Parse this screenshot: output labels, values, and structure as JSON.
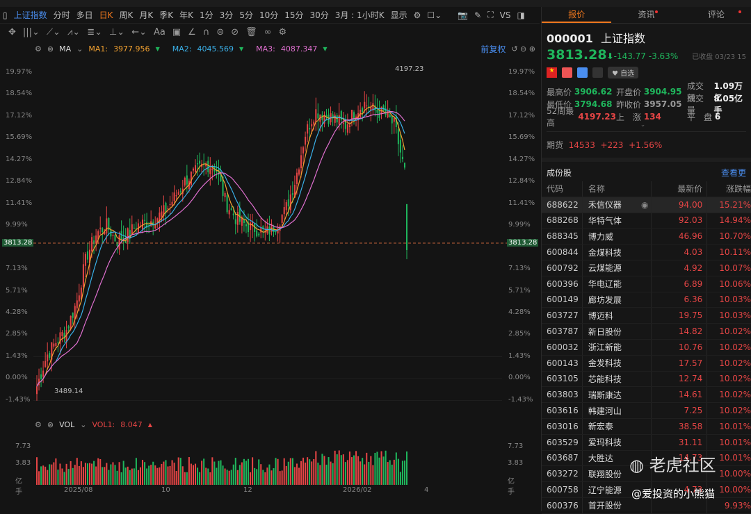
{
  "toolbar": {
    "items": [
      "上证指数",
      "分时",
      "多日",
      "日K",
      "周K",
      "月K",
      "季K",
      "年K",
      "1分",
      "3分",
      "5分",
      "10分",
      "15分",
      "30分",
      "3月 : 1小时K",
      "显示"
    ],
    "selected": "日K",
    "vs": "VS"
  },
  "ma": {
    "label": "MA",
    "ma1": "MA1:",
    "ma1_val": "3977.956",
    "ma2": "MA2:",
    "ma2_val": "4045.569",
    "ma3": "MA3:",
    "ma3_val": "4087.347",
    "adjust": "前复权"
  },
  "axis": {
    "pct": [
      "19.97%",
      "18.54%",
      "17.12%",
      "15.69%",
      "14.27%",
      "12.84%",
      "11.41%",
      "9.99%",
      "8.56%",
      "7.13%",
      "5.71%",
      "4.28%",
      "2.85%",
      "1.43%",
      "0.00%",
      "-1.43%"
    ],
    "current": "3813.28",
    "high_label": "4197.23",
    "low_label": "3489.14"
  },
  "vol": {
    "label": "VOL",
    "vol1": "VOL1:",
    "vol1_val": "8.047",
    "ticks": [
      "7.73",
      "3.83",
      "亿手"
    ],
    "dates": [
      "2025/08",
      "10",
      "12",
      "2026/02",
      "4"
    ]
  },
  "chart_data": {
    "type": "candlestick",
    "ylabel": "%",
    "ylim": [
      -1.9,
      20.5
    ],
    "close_pct_keypoints": [
      -0.5,
      1.5,
      2.5,
      3.2,
      5,
      8,
      9.5,
      10,
      9,
      9.3,
      10,
      10.2,
      10.5,
      11,
      12,
      13,
      13.5,
      14,
      13.8,
      11.5,
      10.5,
      10,
      9.8,
      9.5,
      10,
      11,
      13,
      16,
      17.5,
      17.2,
      17,
      16.5,
      17.5,
      18,
      17.5,
      17.3,
      16.5,
      13.5
    ],
    "last_candle": {
      "open_pct": 11.4,
      "close_pct": 8.4,
      "low_pct": 7.8
    }
  },
  "tabs": [
    {
      "label": "报价"
    },
    {
      "label": "资讯"
    },
    {
      "label": "评论"
    }
  ],
  "quote": {
    "code": "000001",
    "name": "上证指数",
    "price": "3813.28",
    "change": "-143.77",
    "pct": "-3.63%",
    "status": "已收盘 03/23 15",
    "watch": "自选",
    "stats": [
      [
        "最高价",
        "3906.62",
        "g"
      ],
      [
        "开盘价",
        "3904.95",
        "g"
      ],
      [
        "成交额",
        "1.09万亿",
        "w"
      ],
      [
        "最低价",
        "3794.68",
        "g"
      ],
      [
        "昨收价",
        "3957.05",
        "m"
      ],
      [
        "成交量",
        "8.05亿手",
        "w"
      ],
      [
        "52周最高",
        "4197.23",
        "r"
      ],
      [
        "上　涨",
        "134",
        "r"
      ],
      [
        "平　盘",
        "6",
        "w"
      ]
    ],
    "futures": {
      "label": "期货",
      "value": "14533",
      "change": "+223",
      "pct": "+1.56%"
    }
  },
  "constituents": {
    "title": "成份股",
    "more": "查看更",
    "headers": [
      "代码",
      "名称",
      "最新价",
      "涨跌幅"
    ],
    "rows": [
      [
        "688622",
        "禾信仪器",
        "94.00",
        "15.21%"
      ],
      [
        "688268",
        "华特气体",
        "92.03",
        "14.94%"
      ],
      [
        "688345",
        "博力威",
        "46.96",
        "10.70%"
      ],
      [
        "600844",
        "金煤科技",
        "4.03",
        "10.11%"
      ],
      [
        "600792",
        "云煤能源",
        "4.92",
        "10.07%"
      ],
      [
        "600396",
        "华电辽能",
        "6.89",
        "10.06%"
      ],
      [
        "600149",
        "廊坊发展",
        "6.36",
        "10.03%"
      ],
      [
        "603727",
        "博迈科",
        "19.75",
        "10.03%"
      ],
      [
        "603787",
        "新日股份",
        "14.82",
        "10.02%"
      ],
      [
        "600032",
        "浙江新能",
        "10.76",
        "10.02%"
      ],
      [
        "600143",
        "金发科技",
        "17.57",
        "10.02%"
      ],
      [
        "603105",
        "芯能科技",
        "12.74",
        "10.02%"
      ],
      [
        "603803",
        "瑞斯康达",
        "14.61",
        "10.02%"
      ],
      [
        "603616",
        "韩建河山",
        "7.25",
        "10.02%"
      ],
      [
        "603016",
        "新宏泰",
        "38.58",
        "10.01%"
      ],
      [
        "603529",
        "爱玛科技",
        "31.11",
        "10.01%"
      ],
      [
        "603687",
        "大胜达",
        "14.73",
        "10.01%"
      ],
      [
        "603272",
        "联翔股份",
        "",
        "10.00%"
      ],
      [
        "600758",
        "辽宁能源",
        "4.73",
        "10.00%"
      ],
      [
        "600376",
        "首开股份",
        "",
        "9.93%"
      ]
    ]
  },
  "watermark": {
    "brand": "老虎社区",
    "user": "@爱投资的小熊猫"
  },
  "colors": {
    "up": "#e54545",
    "down": "#1fb65c",
    "ma1": "#f0a030",
    "ma2": "#3ab0e8",
    "ma3": "#e070d0",
    "accent": "#f0781e"
  }
}
